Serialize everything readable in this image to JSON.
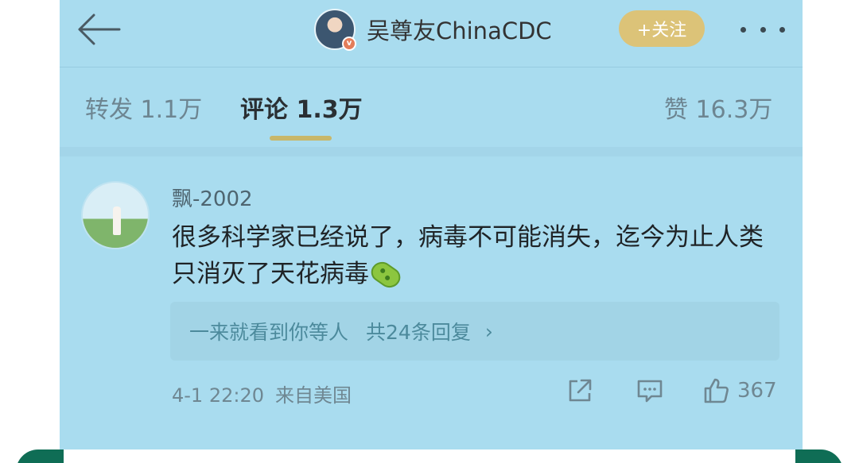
{
  "header": {
    "back_icon": "back-arrow-icon",
    "author_name": "吴尊友ChinaCDC",
    "verified_badge": "v",
    "follow_label": "+关注",
    "more_icon": "more-dots-icon"
  },
  "tabs": {
    "repost": "转发 1.1万",
    "comment": "评论 1.3万",
    "like": "赞 16.3万"
  },
  "comment": {
    "username": "飘-2002",
    "text": "很多科学家已经说了，病毒不可能消失，迄今为止人类只消灭了天花病毒",
    "emoji_icon": "microbe-emoji-icon",
    "replies_preview": "一来就看到你等人",
    "replies_count": "共24条回复",
    "replies_chevron": "›",
    "time": "4-1 22:20",
    "source": "来自美国",
    "like_count": "367"
  },
  "colors": {
    "overlay": "#a9dcef",
    "follow": "#dcc378",
    "tab_underline": "#c8b76a",
    "bottom_bar": "#0f6d55"
  }
}
